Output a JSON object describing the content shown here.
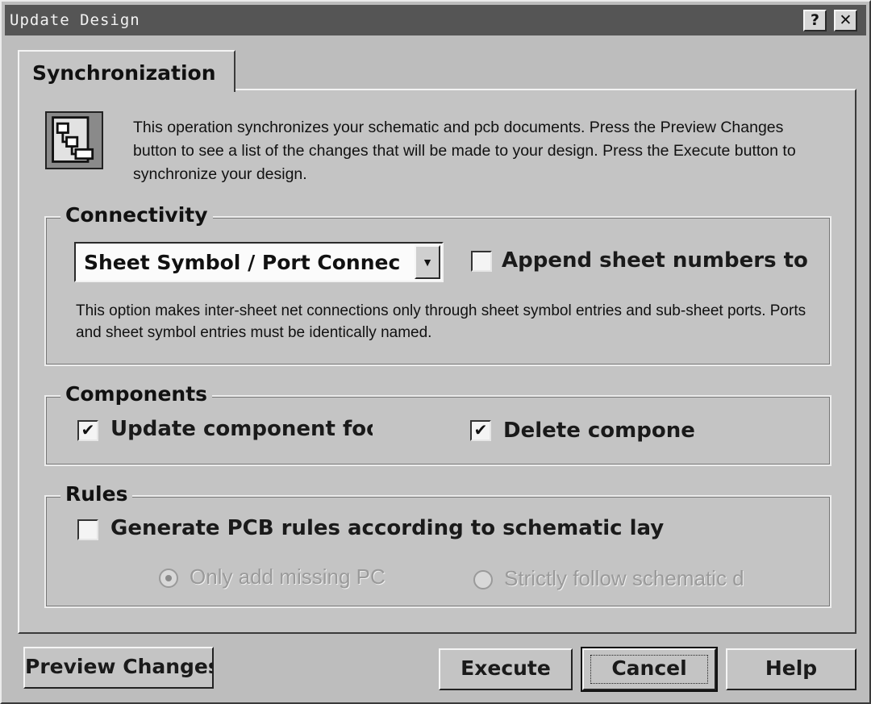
{
  "window": {
    "title": "Update Design",
    "help_button": "?",
    "close_button": "✕"
  },
  "tab": {
    "label": "Synchronization"
  },
  "intro_text": "This operation synchronizes your schematic and pcb documents.  Press the Preview Changes button to see a list of the changes that will be made to your design.  Press the Execute button to synchronize your design.",
  "connectivity": {
    "title": "Connectivity",
    "mode_value": "Sheet Symbol / Port Connec",
    "append_label": "Append sheet numbers to",
    "append_checked": false,
    "description": "This option makes inter-sheet net connections only through sheet symbol entries and sub-sheet ports. Ports and sheet symbol entries must be identically named."
  },
  "components": {
    "title": "Components",
    "update_label": "Update component foo",
    "update_checked": true,
    "delete_label": "Delete compone",
    "delete_checked": true
  },
  "rules": {
    "title": "Rules",
    "generate_label": "Generate PCB rules according to schematic lay",
    "generate_checked": false,
    "option1_label": "Only add missing PC",
    "option1_selected": true,
    "option2_label": "Strictly follow schematic d",
    "option2_selected": false
  },
  "buttons": {
    "preview": "Preview Changes",
    "execute": "Execute",
    "cancel": "Cancel",
    "help": "Help"
  },
  "check_mark": "✔"
}
